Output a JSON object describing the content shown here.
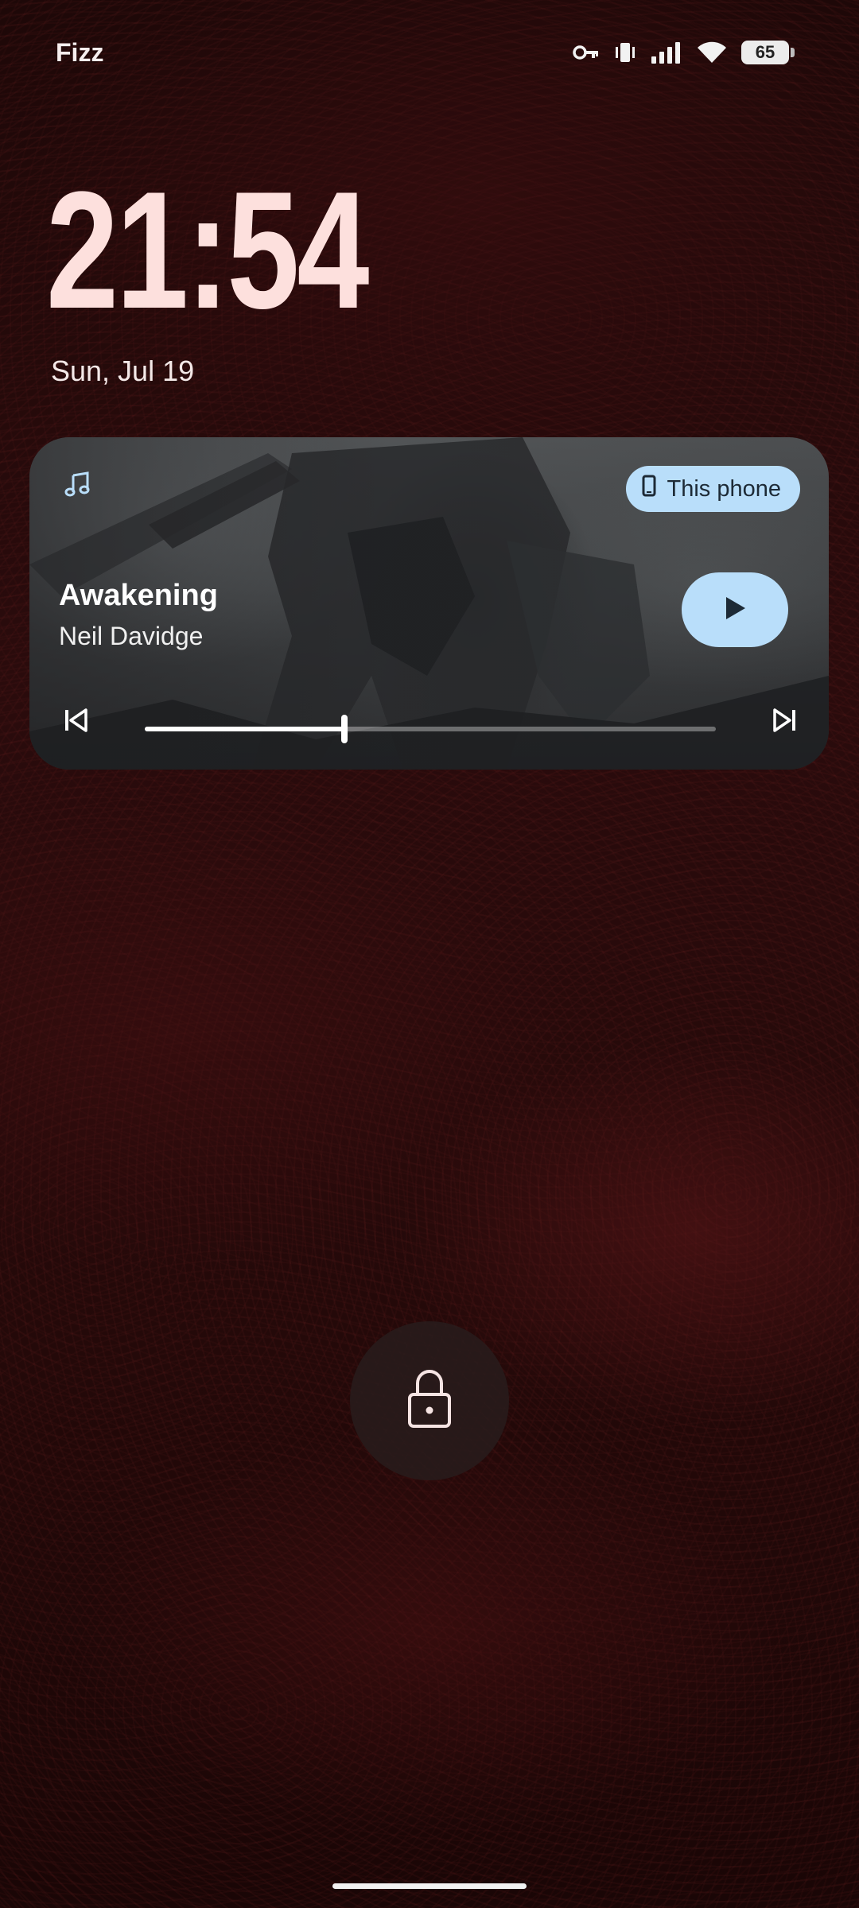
{
  "status_bar": {
    "carrier": "Fizz",
    "battery_level": "65",
    "icons": [
      "vpn-key-icon",
      "vibrate-icon",
      "cellular-signal-icon",
      "wifi-icon",
      "battery-icon"
    ]
  },
  "lockscreen": {
    "time": "21:54",
    "date": "Sun, Jul 19"
  },
  "media": {
    "app_icon": "music-note-icon",
    "output_device": "This phone",
    "title": "Awakening",
    "artist": "Neil Davidge",
    "progress": 0.35,
    "controls": [
      "previous-icon",
      "play-icon",
      "next-icon"
    ]
  },
  "colors": {
    "accent": "#b9defa",
    "clock": "#fde0dd",
    "background": "#240909"
  },
  "lock_icon": "lock-icon"
}
